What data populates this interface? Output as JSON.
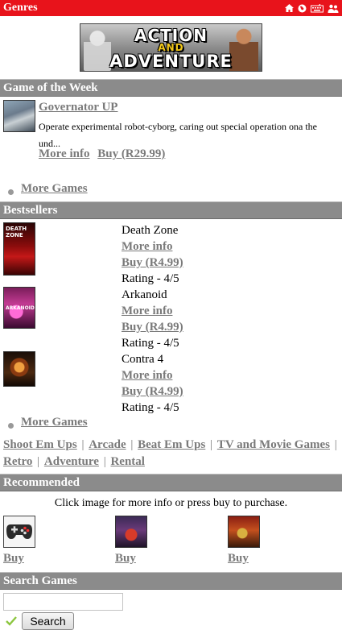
{
  "header": {
    "title": "Genres",
    "icons": [
      "home-icon",
      "globe-icon",
      "keyboard-icon",
      "people-icon"
    ]
  },
  "banner": {
    "line1": "ACTION",
    "line2": "AND",
    "line3": "ADVENTURE"
  },
  "game_of_week": {
    "heading": "Game of the Week",
    "title": "Governator UP",
    "description": "Operate experimental robot-cyborg, caring out special operation ona the und...",
    "more_info": "More info",
    "buy": "Buy (R29.99)",
    "more_games": "More Games"
  },
  "bestsellers": {
    "heading": "Bestsellers",
    "items": [
      {
        "title": "Death Zone",
        "more_info": "More info",
        "buy": "Buy (R4.99)",
        "rating": "Rating - 4/5",
        "thumb_text": "DEATH ZONE"
      },
      {
        "title": "Arkanoid",
        "more_info": "More info",
        "buy": "Buy (R4.99)",
        "rating": "Rating - 4/5",
        "thumb_text": "ARKANOID"
      },
      {
        "title": "Contra 4",
        "more_info": "More info",
        "buy": "Buy (R4.99)",
        "rating": "Rating - 4/5",
        "thumb_text": ""
      }
    ],
    "more_games": "More Games"
  },
  "genres": {
    "links": [
      "Shoot Em Ups",
      "Arcade",
      "Beat Em Ups",
      "TV and Movie Games",
      "Retro",
      "Adventure",
      "Rental"
    ],
    "separator": "|"
  },
  "recommended": {
    "heading": "Recommended",
    "note": "Click image for more info or press buy to purchase.",
    "items": [
      {
        "buy": "Buy",
        "icon": "gamepad-icon"
      },
      {
        "buy": "Buy",
        "icon": "game-cover-icon"
      },
      {
        "buy": "Buy",
        "icon": "game-cover-icon"
      }
    ]
  },
  "search": {
    "heading": "Search Games",
    "value": "",
    "button": "Search"
  },
  "colors": {
    "topbar": "#e8131b",
    "section": "#8b8b8b",
    "link": "#7a7a7a",
    "check": "#8cc63f"
  }
}
